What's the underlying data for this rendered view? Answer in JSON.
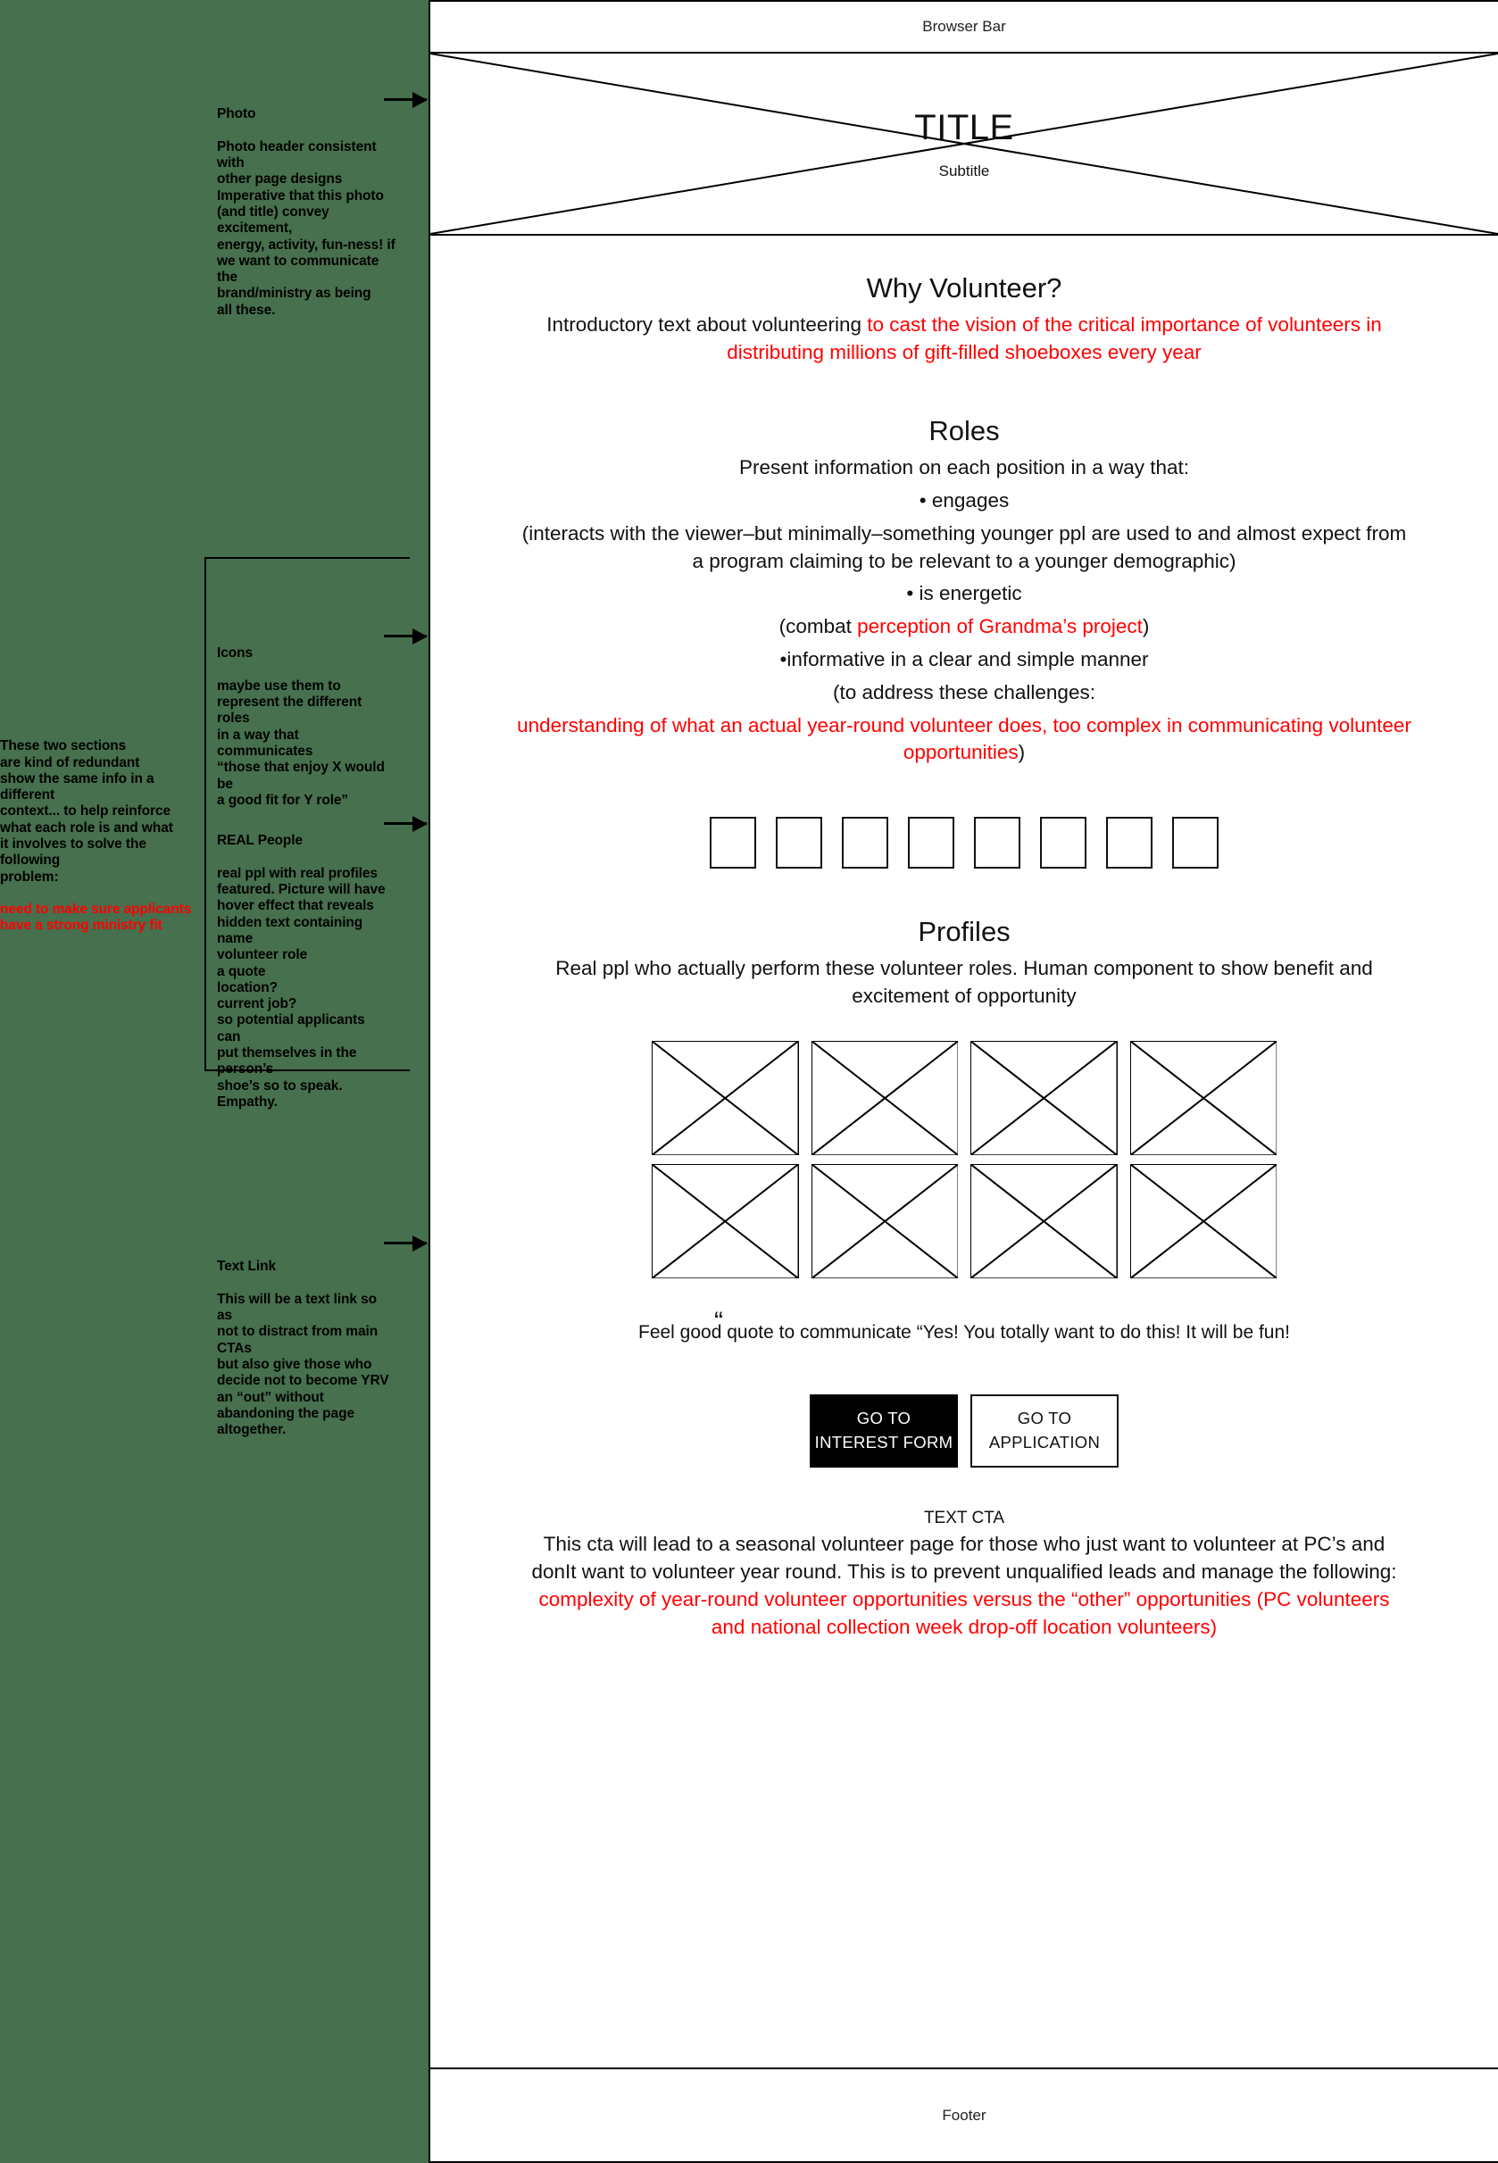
{
  "annotations": {
    "photo": {
      "heading": "Photo",
      "body": "Photo header consistent with\nother page designs\nImperative that this photo\n(and title) convey excitement,\nenergy, activity, fun-ness! if\nwe want to communicate the\nbrand/ministry as being\nall these."
    },
    "redundant": {
      "body_black": "These two sections\nare kind of redundant\nshow the same info in a different\ncontext... to help reinforce\nwhat each role is and what\nit involves to solve the following\nproblem:",
      "body_red": "need to make sure applicants\nhave a strong ministry fit"
    },
    "icons": {
      "heading": "Icons",
      "body": "maybe use them to\nrepresent the different roles\nin a way that communicates\n“those that enjoy X would be\na good fit for Y role”"
    },
    "real_people": {
      "heading": "REAL People",
      "body": "real ppl with real profiles\nfeatured. Picture will have\nhover effect that reveals\nhidden text containing\nname\nvolunteer role\na quote\nlocation?\ncurrent job?\nso potential applicants can\nput themselves in the person’s\nshoe’s so to speak. Empathy."
    },
    "text_link": {
      "heading": "Text Link",
      "body": "This will be a text link so as\nnot to distract from main CTAs\nbut also give those who\ndecide not to become YRV\nan “out” without\nabandoning the page\naltogether."
    }
  },
  "browser": {
    "bar_label": "Browser Bar",
    "hero": {
      "title": "TITLE",
      "subtitle": "Subtitle"
    },
    "why": {
      "heading": "Why Volunteer?",
      "text_black": "Introductory text about volunteering ",
      "text_red": "to cast the vision of the critical importance of volunteers in distributing millions of gift-filled shoeboxes every year"
    },
    "roles": {
      "heading": "Roles",
      "line1": "Present information on each position in a way that:",
      "line2": "• engages",
      "line3": "(interacts with the viewer–but minimally–something younger ppl are used to and almost expect from a program claiming to be relevant to a younger demographic)",
      "line4": "• is energetic",
      "line5_pre": "(combat ",
      "line5_red": "perception of Grandma’s project",
      "line5_post": ")",
      "line6": "•informative in a clear and simple manner",
      "line7": "(to address these challenges:",
      "line8_red": "understanding of what an actual year-round volunteer does, too complex in communicating volunteer opportunities",
      "line8_post": ")"
    },
    "icon_boxes": [
      "icon-placeholder-1",
      "icon-placeholder-2",
      "icon-placeholder-3",
      "icon-placeholder-4",
      "icon-placeholder-5",
      "icon-placeholder-6",
      "icon-placeholder-7",
      "icon-placeholder-8"
    ],
    "profiles": {
      "heading": "Profiles",
      "text": "Real ppl who actually perform these volunteer roles. Human component to show benefit and excitement of opportunity",
      "placeholders": [
        "profile-placeholder-1",
        "profile-placeholder-2",
        "profile-placeholder-3",
        "profile-placeholder-4",
        "profile-placeholder-5",
        "profile-placeholder-6",
        "profile-placeholder-7",
        "profile-placeholder-8"
      ]
    },
    "quote": {
      "mark": "“",
      "text": "Feel good quote to communicate “Yes! You totally want to do this! It will be fun!"
    },
    "cta": {
      "primary_line1": "GO TO",
      "primary_line2": "INTEREST FORM",
      "secondary_line1": "GO TO",
      "secondary_line2": "APPLICATION"
    },
    "text_cta": {
      "label": "TEXT CTA",
      "text_black": "This cta will lead to a seasonal volunteer page for those who just want to volunteer at PC’s and donIt want to volunteer year round. This is to prevent unqualified leads and manage the following: ",
      "text_red": "complexity of year-round volunteer opportunities versus the “other” opportunities (PC volunteers and national collection week drop-off location volunteers)"
    },
    "footer_label": "Footer"
  },
  "colors": {
    "background": "#47704e",
    "accent_red": "#ff0000",
    "ink": "#000000",
    "surface": "#ffffff"
  }
}
